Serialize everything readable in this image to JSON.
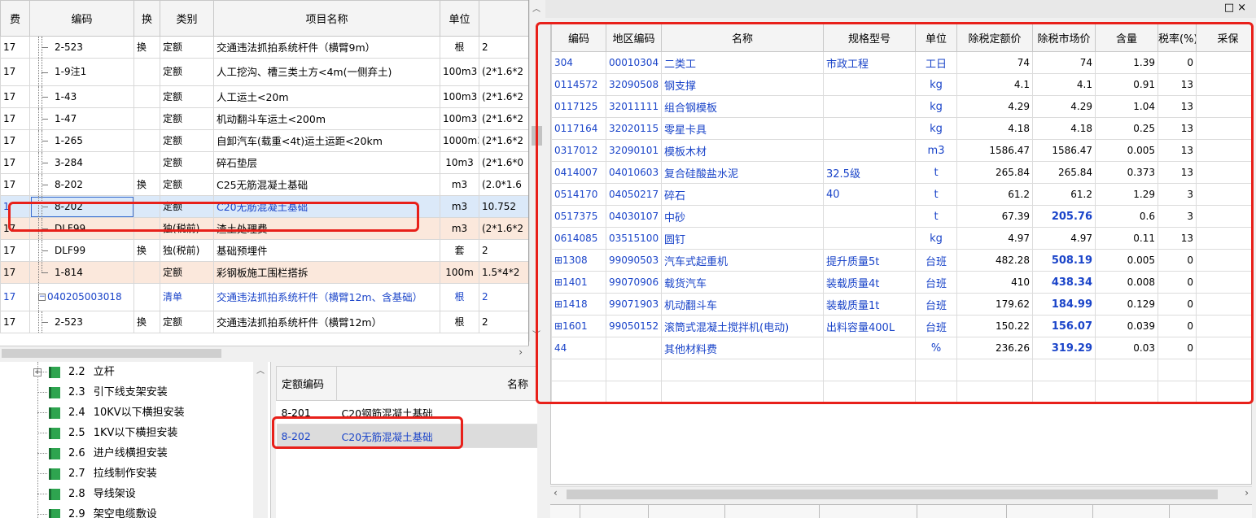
{
  "left_grid": {
    "headers": [
      "费",
      "编码",
      "换",
      "类别",
      "项目名称",
      "单位",
      ""
    ],
    "rows": [
      {
        "fee": "17",
        "code": "2-523",
        "swap": "换",
        "type": "定额",
        "name": "交通违法抓拍系统杆件（横臂9m）",
        "unit": "根",
        "qty": "2"
      },
      {
        "fee": "17",
        "code": "1-9注1",
        "swap": "",
        "type": "定额",
        "name": "人工挖沟、槽三类土方<4m(一侧弃土)",
        "unit": "100m3",
        "qty": "(2*1.6*2"
      },
      {
        "fee": "17",
        "code": "1-43",
        "swap": "",
        "type": "定额",
        "name": "人工运土<20m",
        "unit": "100m3",
        "qty": "(2*1.6*2"
      },
      {
        "fee": "17",
        "code": "1-47",
        "swap": "",
        "type": "定额",
        "name": "机动翻斗车运土<200m",
        "unit": "100m3",
        "qty": "(2*1.6*2"
      },
      {
        "fee": "17",
        "code": "1-265",
        "swap": "",
        "type": "定额",
        "name": "自卸汽车(载重<4t)运土运距<20km",
        "unit": "1000m3",
        "qty": "(2*1.6*2"
      },
      {
        "fee": "17",
        "code": "3-284",
        "swap": "",
        "type": "定额",
        "name": "碎石垫层",
        "unit": "10m3",
        "qty": "(2*1.6*0"
      },
      {
        "fee": "17",
        "code": "8-202",
        "swap": "换",
        "type": "定额",
        "name": "C25无筋混凝土基础",
        "unit": "m3",
        "qty": "(2.0*1.6"
      },
      {
        "fee": "1",
        "code": "8-202",
        "swap": "",
        "type": "定额",
        "name": "C20无筋混凝土基础",
        "unit": "m3",
        "qty": "10.752"
      },
      {
        "fee": "17",
        "code": "DLF99",
        "swap": "",
        "type": "独(税前)",
        "name": "渣土处理费",
        "unit": "m3",
        "qty": "(2*1.6*2"
      },
      {
        "fee": "17",
        "code": "DLF99",
        "swap": "换",
        "type": "独(税前)",
        "name": "基础预埋件",
        "unit": "套",
        "qty": "2"
      },
      {
        "fee": "17",
        "code": "1-814",
        "swap": "",
        "type": "定额",
        "name": "彩钢板施工围栏搭拆",
        "unit": "100m",
        "qty": "1.5*4*2"
      },
      {
        "fee": "17",
        "code": "040205003018",
        "swap": "",
        "type": "清单",
        "name": "交通违法抓拍系统杆件（横臂12m、含基础）",
        "unit": "根",
        "qty": "2"
      },
      {
        "fee": "17",
        "code": "2-523",
        "swap": "换",
        "type": "定额",
        "name": "交通违法抓拍系统杆件（横臂12m）",
        "unit": "根",
        "qty": "2"
      }
    ]
  },
  "tree": {
    "items": [
      {
        "num": "2.2",
        "label": "立杆"
      },
      {
        "num": "2.3",
        "label": "引下线支架安装"
      },
      {
        "num": "2.4",
        "label": "10KV以下横担安装"
      },
      {
        "num": "2.5",
        "label": "1KV以下横担安装"
      },
      {
        "num": "2.6",
        "label": "进户线横担安装"
      },
      {
        "num": "2.7",
        "label": "拉线制作安装"
      },
      {
        "num": "2.8",
        "label": "导线架设"
      },
      {
        "num": "2.9",
        "label": "架空电缆敷设"
      }
    ]
  },
  "quota_list": {
    "headers": [
      "定额编码",
      "名称"
    ],
    "rows": [
      {
        "code": "8-201",
        "name": "C20钢筋混凝土基础"
      },
      {
        "code": "8-202",
        "name": "C20无筋混凝土基础"
      }
    ]
  },
  "right_panel": {
    "window_buttons": "□×",
    "headers": [
      "编码",
      "地区编码",
      "名称",
      "规格型号",
      "单位",
      "除税定额价",
      "除税市场价",
      "含量",
      "税率(%)",
      "采保"
    ],
    "rows": [
      {
        "code": "304",
        "region": "00010304",
        "name": "二类工",
        "spec": "市政工程",
        "unit": "工日",
        "quota": "74",
        "market": "74",
        "content": "1.39",
        "tax": "0",
        "bold": false
      },
      {
        "code": "0114572",
        "region": "32090508",
        "name": "钢支撑",
        "spec": "",
        "unit": "kg",
        "quota": "4.1",
        "market": "4.1",
        "content": "0.91",
        "tax": "13",
        "bold": false
      },
      {
        "code": "0117125",
        "region": "32011111",
        "name": "组合钢模板",
        "spec": "",
        "unit": "kg",
        "quota": "4.29",
        "market": "4.29",
        "content": "1.04",
        "tax": "13",
        "bold": false
      },
      {
        "code": "0117164",
        "region": "32020115",
        "name": "零星卡具",
        "spec": "",
        "unit": "kg",
        "quota": "4.18",
        "market": "4.18",
        "content": "0.25",
        "tax": "13",
        "bold": false
      },
      {
        "code": "0317012",
        "region": "32090101",
        "name": "模板木材",
        "spec": "",
        "unit": "m3",
        "quota": "1586.47",
        "market": "1586.47",
        "content": "0.005",
        "tax": "13",
        "bold": false
      },
      {
        "code": "0414007",
        "region": "04010603",
        "name": "复合硅酸盐水泥",
        "spec": "32.5级",
        "unit": "t",
        "quota": "265.84",
        "market": "265.84",
        "content": "0.373",
        "tax": "13",
        "bold": false
      },
      {
        "code": "0514170",
        "region": "04050217",
        "name": "碎石",
        "spec": "40",
        "unit": "t",
        "quota": "61.2",
        "market": "61.2",
        "content": "1.29",
        "tax": "3",
        "bold": false
      },
      {
        "code": "0517375",
        "region": "04030107",
        "name": "中砂",
        "spec": "",
        "unit": "t",
        "quota": "67.39",
        "market": "205.76",
        "content": "0.6",
        "tax": "3",
        "bold": true
      },
      {
        "code": "0614085",
        "region": "03515100",
        "name": "圆钉",
        "spec": "",
        "unit": "kg",
        "quota": "4.97",
        "market": "4.97",
        "content": "0.11",
        "tax": "13",
        "bold": false
      },
      {
        "code": "⊞1308",
        "region": "99090503",
        "name": "汽车式起重机",
        "spec": "提升质量5t",
        "unit": "台班",
        "quota": "482.28",
        "market": "508.19",
        "content": "0.005",
        "tax": "0",
        "bold": true
      },
      {
        "code": "⊞1401",
        "region": "99070906",
        "name": "载货汽车",
        "spec": "装载质量4t",
        "unit": "台班",
        "quota": "410",
        "market": "438.34",
        "content": "0.008",
        "tax": "0",
        "bold": true
      },
      {
        "code": "⊞1418",
        "region": "99071903",
        "name": "机动翻斗车",
        "spec": "装载质量1t",
        "unit": "台班",
        "quota": "179.62",
        "market": "184.99",
        "content": "0.129",
        "tax": "0",
        "bold": true
      },
      {
        "code": "⊞1601",
        "region": "99050152",
        "name": "滚筒式混凝土搅拌机(电动)",
        "spec": "出料容量400L",
        "unit": "台班",
        "quota": "150.22",
        "market": "156.07",
        "content": "0.039",
        "tax": "0",
        "bold": true
      },
      {
        "code": "44",
        "region": "",
        "name": "其他材料费",
        "spec": "",
        "unit": "%",
        "quota": "236.26",
        "market": "319.29",
        "content": "0.03",
        "tax": "0",
        "bold": true
      }
    ]
  },
  "colors": {
    "highlight_red": "#e8201a",
    "link_blue": "#1a44c9",
    "sub_row_peach": "#fbe8dc",
    "selected_row_blue": "#dbe9f9"
  }
}
